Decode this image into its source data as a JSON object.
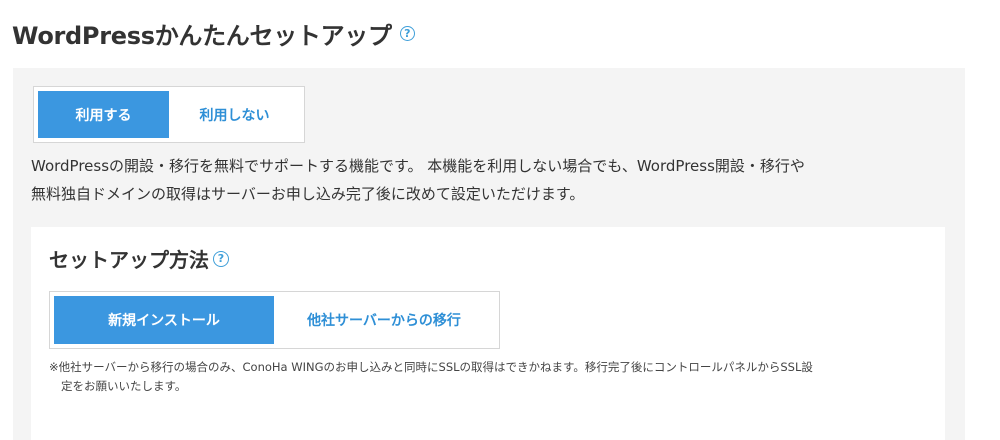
{
  "header": {
    "title": "WordPressかんたんセットアップ",
    "help_icon": "help-circle-icon"
  },
  "wordpress_toggle": {
    "options": [
      "利用する",
      "利用しない"
    ],
    "selected": "利用する"
  },
  "description": {
    "line1": "WordPressの開設・移行を無料でサポートする機能です。 本機能を利用しない場合でも、WordPress開設・移行や",
    "line2": "無料独自ドメインの取得はサーバーお申し込み完了後に改めて設定いただけます。"
  },
  "setup_method": {
    "title": "セットアップ方法",
    "help_icon": "help-circle-icon",
    "options": [
      "新規インストール",
      "他社サーバーからの移行"
    ],
    "selected": "新規インストール",
    "note_line1": "※他社サーバーから移行の場合のみ、ConoHa WINGのお申し込みと同時にSSLの取得はできかねます。移行完了後にコントロールパネルからSSL設",
    "note_line2": "定をお願いいたします。"
  },
  "colors": {
    "accent": "#3b97e0",
    "link": "#2e8fd6",
    "panel": "#f4f4f4"
  }
}
